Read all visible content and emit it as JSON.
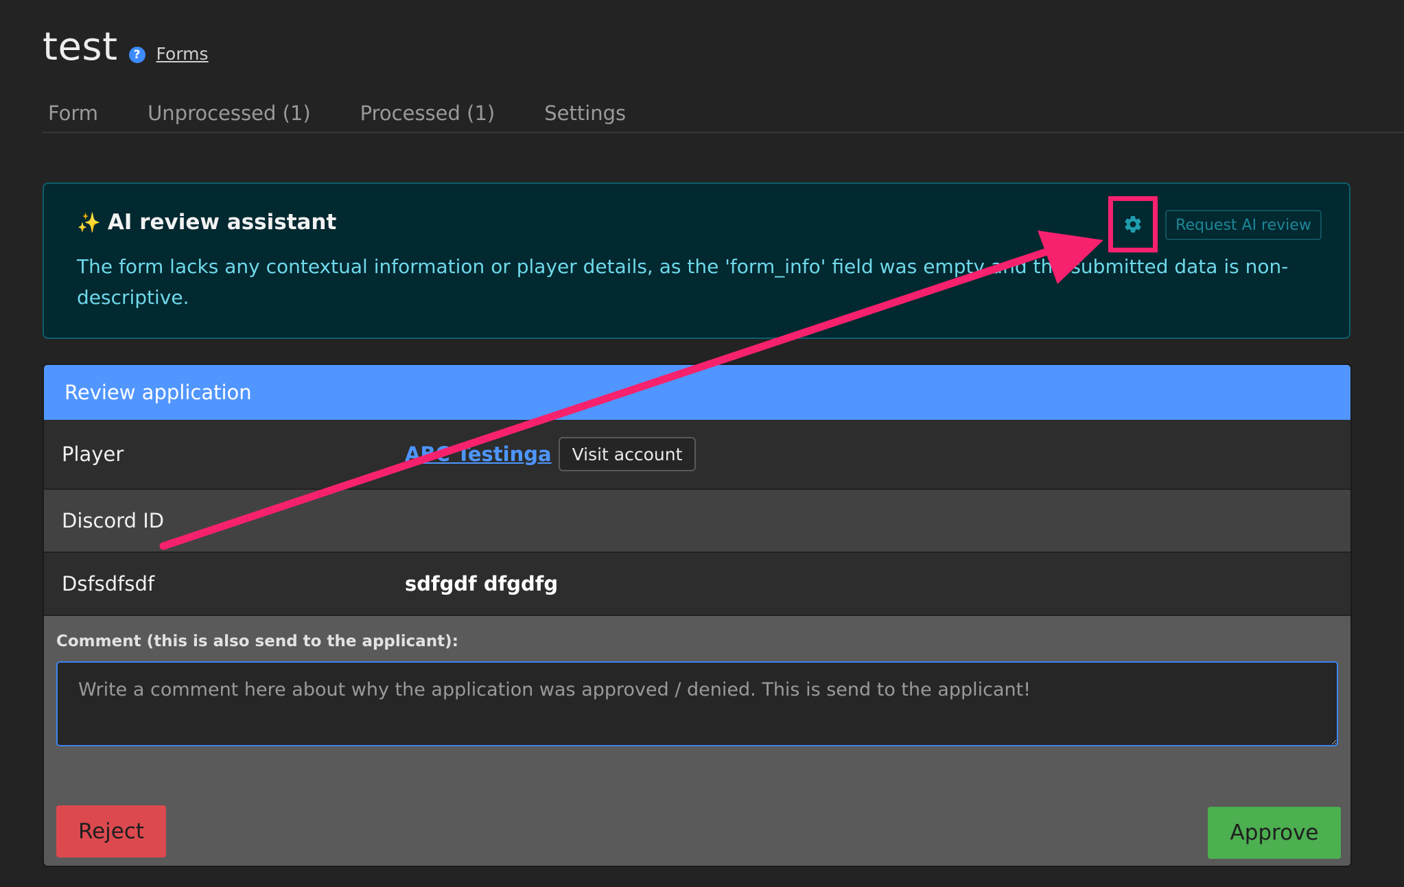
{
  "page": {
    "title": "test",
    "help_icon": "?",
    "forms_link": "Forms"
  },
  "tabs": [
    {
      "label": "Form"
    },
    {
      "label": "Unprocessed (1)"
    },
    {
      "label": "Processed (1)"
    },
    {
      "label": "Settings"
    }
  ],
  "ai_panel": {
    "title": "AI review assistant",
    "sparkle_icon": "✨",
    "text": "The form lacks any contextual information or player details, as the 'form_info' field was empty and the submitted data is non-descriptive.",
    "request_button": "Request AI review",
    "gear_icon": "gear-icon"
  },
  "review": {
    "header": "Review application",
    "rows": [
      {
        "label": "Player",
        "link": "ABC Testinga",
        "button": "Visit account"
      },
      {
        "label": "Discord ID",
        "value": ""
      },
      {
        "label": "Dsfsdfsdf",
        "value": "sdfgdf dfgdfg"
      }
    ],
    "comment_label": "Comment (this is also send to the applicant):",
    "comment_placeholder": "Write a comment here about why the application was approved / denied. This is send to the applicant!",
    "comment_value": "",
    "reject_button": "Reject",
    "approve_button": "Approve"
  },
  "colors": {
    "background": "#232323",
    "ai_panel_bg": "#022830",
    "ai_text": "#6fd9ea",
    "card_header": "#5196ff",
    "reject": "#dc4a4f",
    "approve": "#4caf50",
    "annotation": "#f7216d"
  }
}
